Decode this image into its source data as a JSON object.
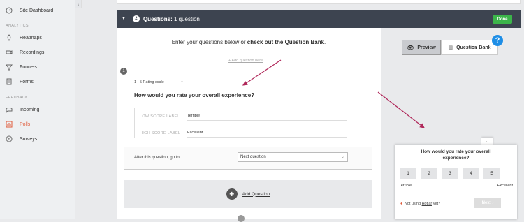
{
  "sidebar": {
    "items_top": [
      {
        "label": "Site Dashboard",
        "icon": "gauge-icon"
      }
    ],
    "analytics_heading": "ANALYTICS",
    "analytics_items": [
      {
        "label": "Heatmaps",
        "icon": "heatmap-icon"
      },
      {
        "label": "Recordings",
        "icon": "video-icon"
      },
      {
        "label": "Funnels",
        "icon": "funnel-icon"
      },
      {
        "label": "Forms",
        "icon": "form-icon"
      }
    ],
    "feedback_heading": "FEEDBACK",
    "feedback_items": [
      {
        "label": "Incoming",
        "icon": "inbox-icon"
      },
      {
        "label": "Polls",
        "icon": "poll-icon",
        "active": true
      },
      {
        "label": "Surveys",
        "icon": "survey-icon"
      }
    ]
  },
  "header": {
    "step_number": "2",
    "title_bold": "Questions:",
    "title_rest": " 1 question",
    "done_label": "Done"
  },
  "intro": {
    "text": "Enter your questions below or ",
    "link": "check out the Question Bank",
    "tail": "."
  },
  "add_question_link": "+ Add question here",
  "question_card": {
    "number": "1",
    "rating_type": "1 - 5 Rating scale",
    "question_text": "How would you rate your overall experience?",
    "low_label_caption": "LOW SCORE LABEL",
    "low_label_value": "Terrible",
    "high_label_caption": "HIGH SCORE LABEL",
    "high_label_value": "Excellent",
    "goto_label": "After this question, go to:",
    "goto_value": "Next question"
  },
  "add_question_button": "Add Question",
  "preview_panel": {
    "preview_label": "Preview",
    "question_bank_label": "Question Bank",
    "help_label": "?",
    "widget": {
      "question": "How would you rate your overall experience?",
      "ratings": [
        "1",
        "2",
        "3",
        "4",
        "5"
      ],
      "low_label": "Terrible",
      "high_label": "Excellent",
      "footer_text": "Not using ",
      "footer_link": "Hotjar",
      "footer_tail": " yet?",
      "next_label": "Next"
    }
  },
  "colors": {
    "header_bg": "#3d4450",
    "done_green": "#3cb54a",
    "active_red": "#e05a3a",
    "help_blue": "#1e8ee6",
    "arrow_crimson": "#b0285a"
  }
}
